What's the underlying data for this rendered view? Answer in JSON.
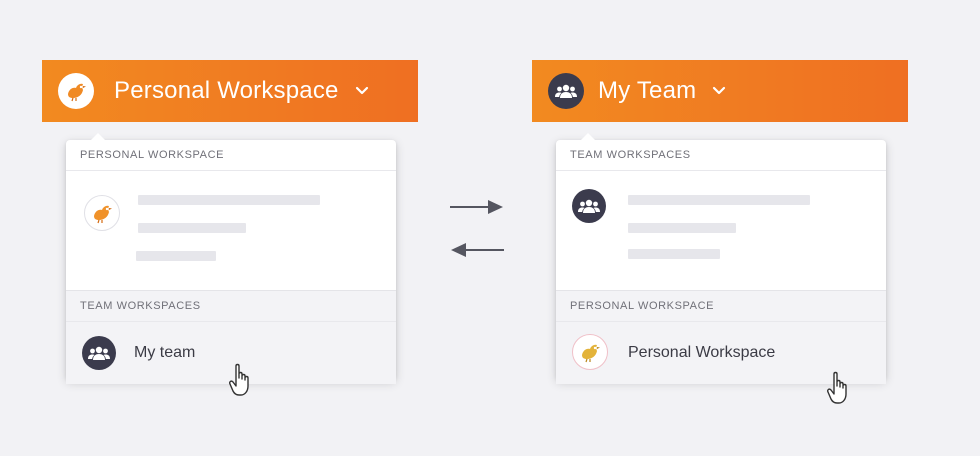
{
  "left": {
    "header": {
      "title": "Personal Workspace",
      "icon": "bird-icon"
    },
    "dropdown": {
      "top_section_label": "PERSONAL WORKSPACE",
      "bottom_section_label": "TEAM WORKSPACES",
      "item": {
        "label": "My team",
        "icon": "team-icon"
      }
    }
  },
  "right": {
    "header": {
      "title": "My Team",
      "icon": "team-icon"
    },
    "dropdown": {
      "top_section_label": "TEAM WORKSPACES",
      "bottom_section_label": "PERSONAL WORKSPACE",
      "item": {
        "label": "Personal Workspace",
        "icon": "bird-icon"
      }
    }
  },
  "colors": {
    "accent_orange": "#f07a22",
    "avatar_dark": "#3b3b4d",
    "background": "#f2f2f5",
    "placeholder": "#e6e6eb"
  }
}
